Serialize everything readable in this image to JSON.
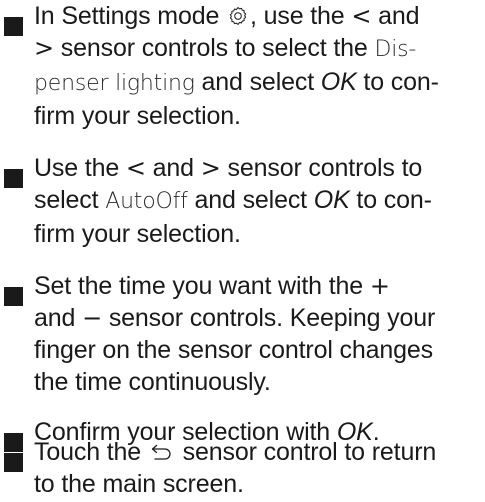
{
  "steps": [
    {
      "l1_a": "In Settings mode ",
      "l1_b": ", use the ",
      "l1_less": "<",
      "l1_c": " and",
      "l2_greater": ">",
      "l2_a": " sensor controls to select the ",
      "l2_lcd": "Dis-",
      "l3_lcd": "penser lighting",
      "l3_a": " and select ",
      "l3_ok": "OK",
      "l3_b": " to con-",
      "l4_a": "firm your selection."
    },
    {
      "l1_a": "Use the ",
      "l1_less": "<",
      "l1_b": " and ",
      "l1_greater": ">",
      "l1_c": " sensor controls to",
      "l2_a": "select ",
      "l2_lcd": "AutoOff",
      "l2_b": " and select ",
      "l2_ok": "OK",
      "l2_c": " to con-",
      "l3_a": "firm your selection."
    },
    {
      "l1_a": "Set the time you want with the ",
      "l1_plus": "+",
      "l2_a": "and ",
      "l2_minus": "−",
      "l2_b": " sensor controls. Keeping your",
      "l3_a": "finger on the sensor control changes",
      "l4_a": "the time continuously."
    },
    {
      "l1_a": "Confirm your selection with ",
      "l1_ok": "OK",
      "l1_b": "."
    },
    {
      "l1_a": "Touch the ",
      "l1_b": " sensor control to return",
      "l2_a": "to the main screen."
    }
  ],
  "icons": {
    "settings": "gear-icon",
    "back": "back-arrow-icon"
  }
}
